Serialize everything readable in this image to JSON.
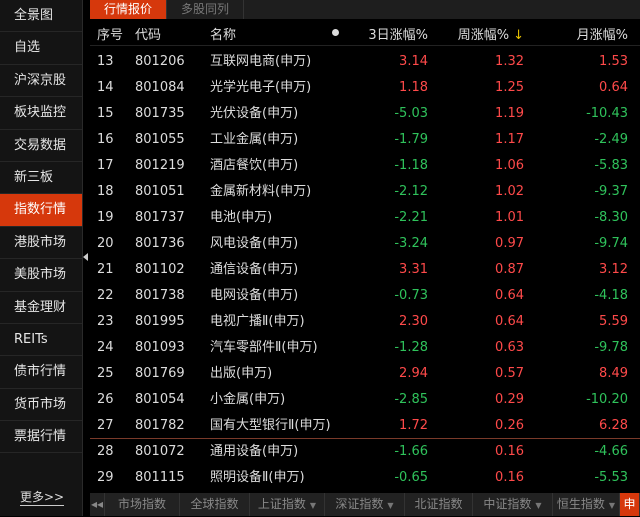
{
  "sidebar": {
    "items": [
      "全景图",
      "自选",
      "沪深京股",
      "板块监控",
      "交易数据",
      "新三板",
      "指数行情",
      "港股市场",
      "美股市场",
      "基金理财",
      "REITs",
      "债市行情",
      "货币市场",
      "票据行情"
    ],
    "active": 6,
    "more": "更多>>"
  },
  "tabs": [
    {
      "label": "行情报价",
      "active": true
    },
    {
      "label": "多股同列",
      "active": false
    }
  ],
  "columns": {
    "seq": "序号",
    "code": "代码",
    "name": "名称",
    "d3": "3日涨幅%",
    "week": "周涨幅%",
    "month": "月涨幅%",
    "sort_arrow": "↓"
  },
  "rows": [
    [
      "13",
      "801206",
      "互联网电商(申万)",
      "3.14",
      "1.32",
      "1.53"
    ],
    [
      "14",
      "801084",
      "光学光电子(申万)",
      "1.18",
      "1.25",
      "0.64"
    ],
    [
      "15",
      "801735",
      "光伏设备(申万)",
      "-5.03",
      "1.19",
      "-10.43"
    ],
    [
      "16",
      "801055",
      "工业金属(申万)",
      "-1.79",
      "1.17",
      "-2.49"
    ],
    [
      "17",
      "801219",
      "酒店餐饮(申万)",
      "-1.18",
      "1.06",
      "-5.83"
    ],
    [
      "18",
      "801051",
      "金属新材料(申万)",
      "-2.12",
      "1.02",
      "-9.37"
    ],
    [
      "19",
      "801737",
      "电池(申万)",
      "-2.21",
      "1.01",
      "-8.30"
    ],
    [
      "20",
      "801736",
      "风电设备(申万)",
      "-3.24",
      "0.97",
      "-9.74"
    ],
    [
      "21",
      "801102",
      "通信设备(申万)",
      "3.31",
      "0.87",
      "3.12"
    ],
    [
      "22",
      "801738",
      "电网设备(申万)",
      "-0.73",
      "0.64",
      "-4.18"
    ],
    [
      "23",
      "801995",
      "电视广播Ⅱ(申万)",
      "2.30",
      "0.64",
      "5.59"
    ],
    [
      "24",
      "801093",
      "汽车零部件Ⅱ(申万)",
      "-1.28",
      "0.63",
      "-9.78"
    ],
    [
      "25",
      "801769",
      "出版(申万)",
      "2.94",
      "0.57",
      "8.49"
    ],
    [
      "26",
      "801054",
      "小金属(申万)",
      "-2.85",
      "0.29",
      "-10.20"
    ],
    [
      "27",
      "801782",
      "国有大型银行Ⅱ(申万)",
      "1.72",
      "0.26",
      "6.28"
    ],
    [
      "28",
      "801072",
      "通用设备(申万)",
      "-1.66",
      "0.16",
      "-4.66"
    ],
    [
      "29",
      "801115",
      "照明设备Ⅱ(申万)",
      "-0.65",
      "0.16",
      "-5.53"
    ]
  ],
  "bottom_tabs": [
    {
      "label": "市场指数",
      "dropdown": false
    },
    {
      "label": "全球指数",
      "dropdown": false
    },
    {
      "label": "上证指数",
      "dropdown": true
    },
    {
      "label": "深证指数",
      "dropdown": true
    },
    {
      "label": "北证指数",
      "dropdown": false
    },
    {
      "label": "中证指数",
      "dropdown": true
    },
    {
      "label": "恒生指数",
      "dropdown": true
    },
    {
      "label": "申",
      "dropdown": false
    }
  ],
  "colors": {
    "accent": "#d6380c",
    "up": "#ff4a4a",
    "down": "#2fc25b",
    "sort_arrow": "#e8c200"
  }
}
